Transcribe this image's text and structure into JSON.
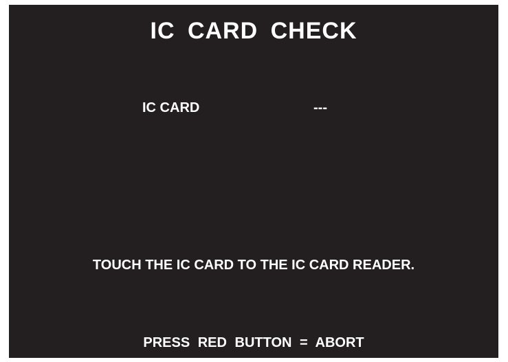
{
  "screen": {
    "title": "IC CARD CHECK",
    "ic_card_label": "IC CARD",
    "ic_card_value": "---",
    "instruction": "TOUCH THE IC CARD TO THE IC CARD READER.",
    "abort_hint": "PRESS RED BUTTON = ABORT"
  },
  "colors": {
    "background": "#231f20",
    "text": "#ffffff"
  }
}
